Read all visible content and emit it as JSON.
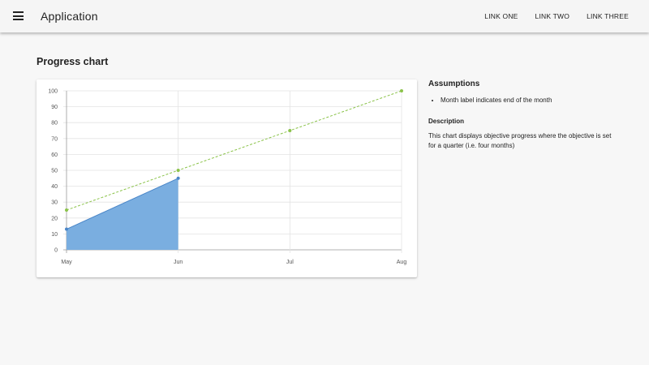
{
  "appbar": {
    "title": "Application",
    "links": [
      "LINK ONE",
      "LINK TWO",
      "LINK THREE"
    ]
  },
  "page": {
    "title": "Progress chart"
  },
  "side": {
    "assumptions_title": "Assumptions",
    "assumptions": [
      "Month label indicates end of the month"
    ],
    "description_title": "Description",
    "description": "This chart displays objective progress where the objective is set for a quarter (i.e. four months)"
  },
  "colors": {
    "actual": "#4a86c8",
    "actual_fill": "#7aaee0",
    "target": "#8bc34a"
  },
  "chart_data": {
    "type": "area",
    "categories": [
      "May",
      "Jun",
      "Jul",
      "Aug"
    ],
    "ylim": [
      0,
      100
    ],
    "yticks": [
      0,
      10,
      20,
      30,
      40,
      50,
      60,
      70,
      80,
      90,
      100
    ],
    "series": [
      {
        "values": [
          13,
          45
        ]
      },
      {
        "values": [
          25,
          50,
          75,
          100
        ]
      }
    ],
    "grid": true,
    "legend": "none"
  }
}
